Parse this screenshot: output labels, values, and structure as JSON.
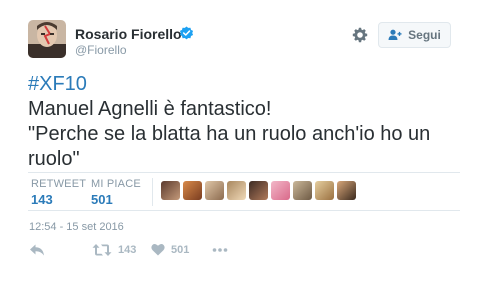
{
  "header": {
    "display_name": "Rosario Fiorello",
    "handle": "@Fiorello",
    "verified_icon": "verified-badge-icon",
    "follow_label": "Segui"
  },
  "tweet": {
    "hashtag": "#XF10",
    "line1": "Manuel Agnelli è fantastico!",
    "line2": "\"Perche se la blatta ha un ruolo anch'io ho un",
    "line3": "ruolo\""
  },
  "stats": {
    "retweet_label": "RETWEET",
    "retweet_count": "143",
    "likes_label": "MI PIACE",
    "likes_count": "501"
  },
  "timestamp": "12:54 - 15 set 2016",
  "actions": {
    "retweet_count": "143",
    "like_count": "501"
  },
  "colors": {
    "link": "#2b7bb9",
    "muted": "#8899a6",
    "text": "#292f33",
    "border": "#e1e8ed",
    "verified": "#1da1f2"
  }
}
